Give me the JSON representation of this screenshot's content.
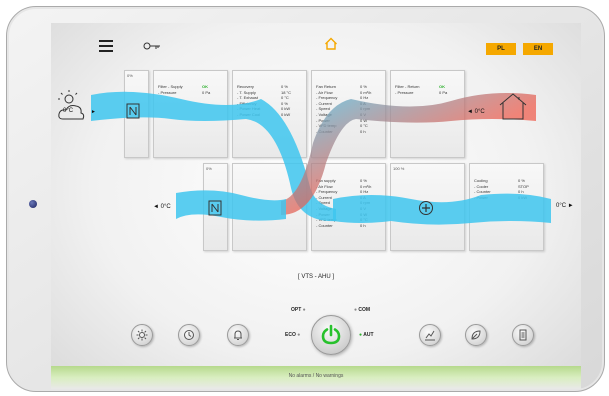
{
  "header": {
    "icons": [
      "hamburger-menu-icon",
      "key-icon",
      "home-icon"
    ],
    "languages": [
      "PL",
      "EN"
    ],
    "accent": "#f5a800"
  },
  "supply": {
    "damper_pct": "0%",
    "filter": {
      "rows": [
        {
          "label": "Filter - Supply",
          "value": "OK"
        },
        {
          "label": "- Pressure",
          "value": "0 Pa"
        }
      ]
    },
    "recovery": {
      "pct": "0 %",
      "rows": [
        {
          "label": "Recovery",
          "value": "0 %"
        },
        {
          "label": "- T. Supply",
          "value": "18 °C"
        },
        {
          "label": "- T. Exhaust",
          "value": "0 °C"
        },
        {
          "label": "- Efficiency",
          "value": "0 %"
        },
        {
          "label": "- Power Heat",
          "value": "0 kW"
        },
        {
          "label": "- Power Cool",
          "value": "0 kW"
        }
      ]
    },
    "fan_return": {
      "rows": [
        {
          "label": "Fan Return",
          "value": "0 %"
        },
        {
          "label": "- Air Flow",
          "value": "0 m³/h"
        },
        {
          "label": "- Frequency",
          "value": "0 Hz"
        },
        {
          "label": "- Current",
          "value": "0 A"
        },
        {
          "label": "- Speed",
          "value": "0 rpm"
        },
        {
          "label": "- Voltage",
          "value": "0 V"
        },
        {
          "label": "- Power",
          "value": "0 W"
        },
        {
          "label": "- VFD temp",
          "value": "0 °C"
        },
        {
          "label": "- Counter",
          "value": "0 h"
        }
      ]
    },
    "filter_return": {
      "rows": [
        {
          "label": "Filter - Return",
          "value": "OK"
        },
        {
          "label": "- Pressure",
          "value": "0 Pa"
        }
      ]
    },
    "outdoor_temp": "0°C",
    "return_temp": "◄ 0°C"
  },
  "exhaust": {
    "damper_pct": "0%",
    "exhaust_temp": "◄ 0°C",
    "fan_supply": {
      "rows": [
        {
          "label": "Fan supply",
          "value": "0 %"
        },
        {
          "label": "- Air Flow",
          "value": "0 m³/h"
        },
        {
          "label": "- Frequency",
          "value": "0 Hz"
        },
        {
          "label": "- Current",
          "value": "0 A"
        },
        {
          "label": "- Speed",
          "value": "0 rpm"
        },
        {
          "label": "- Voltage",
          "value": "0 V"
        },
        {
          "label": "- Power",
          "value": "0 W"
        },
        {
          "label": "- VFD temp",
          "value": "0 °C"
        },
        {
          "label": "- Counter",
          "value": "0 h"
        }
      ]
    },
    "heater_pct": "100 %",
    "cooling": {
      "rows": [
        {
          "label": "Cooling",
          "value": "0 %"
        },
        {
          "label": "- Cooler",
          "value": "STOP"
        },
        {
          "label": "- Counter",
          "value": "0 h"
        },
        {
          "label": "- Power",
          "value": "0 kW"
        }
      ]
    },
    "supply_temp": "0°C ►"
  },
  "unit_title": "[ VTS - AHU ]",
  "modes": {
    "opt": "OPT",
    "com": "COM",
    "eco": "ECO",
    "aut": "AUT"
  },
  "active_mode": "AUT",
  "bottom_icons_left": [
    "settings-icon",
    "schedule-icon",
    "alarm-bell-icon"
  ],
  "bottom_icons_right": [
    "chart-icon",
    "leaf-icon",
    "report-icon"
  ],
  "status_text": "No alarms / No warnings",
  "colors": {
    "flow_blue": "#3ec6ee",
    "flow_red": "#ef5a4a",
    "ok_green": "#2db02d",
    "power_green": "#27c12c"
  }
}
